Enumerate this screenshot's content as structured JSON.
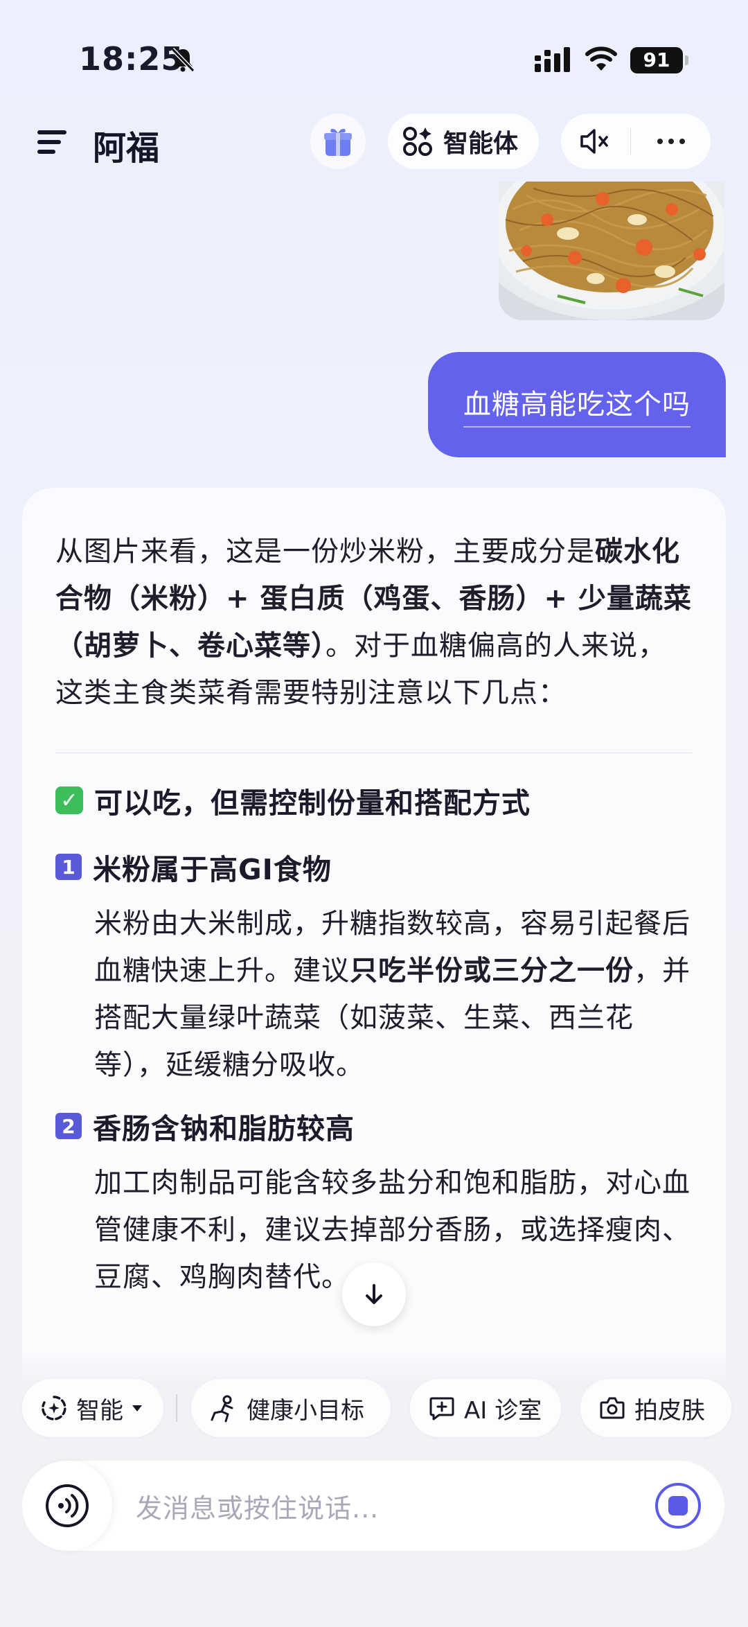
{
  "status_bar": {
    "time": "18:25",
    "battery": "91"
  },
  "header": {
    "title": "阿福",
    "agent_label": "智能体"
  },
  "chat": {
    "user_message": "血糖高能吃这个吗",
    "answer": {
      "intro_1": "从图片来看，这是一份炒米粉，主要成分是",
      "intro_bold": "碳水化合物（米粉）+ 蛋白质（鸡蛋、香肠）+ 少量蔬菜（胡萝卜、卷心菜等）",
      "intro_2": "。对于血糖偏高的人来说，这类主食类菜肴需要特别注意以下几点：",
      "check_heading": "可以吃，但需控制份量和搭配方式",
      "points": [
        {
          "num": "1",
          "title": "米粉属于高GI食物",
          "text_1": "米粉由大米制成，升糖指数较高，容易引起餐后血糖快速上升。建议",
          "text_bold": "只吃半份或三分之一份",
          "text_2": "，并搭配大量绿叶蔬菜（如菠菜、生菜、西兰花等），延缓糖分吸收。"
        },
        {
          "num": "2",
          "title": "香肠含钠和脂肪较高",
          "text_1": "加工肉制品可能含较多盐分和饱和脂肪，对心血管健康不利，建议去掉部分香肠，或选择瘦肉、豆腐、鸡胸肉替代。",
          "text_bold": "",
          "text_2": ""
        }
      ]
    }
  },
  "chips": [
    {
      "label": "智能",
      "icon": "smart-icon"
    },
    {
      "label": "健康小目标",
      "icon": "goal-icon"
    },
    {
      "label": "AI 诊室",
      "icon": "clinic-icon"
    },
    {
      "label": "拍皮肤",
      "icon": "camera-icon"
    }
  ],
  "input": {
    "placeholder": "发消息或按住说话..."
  },
  "colors": {
    "accent": "#6461ec",
    "check": "#3cbf5a",
    "number_badge": "#5a5ad8"
  }
}
